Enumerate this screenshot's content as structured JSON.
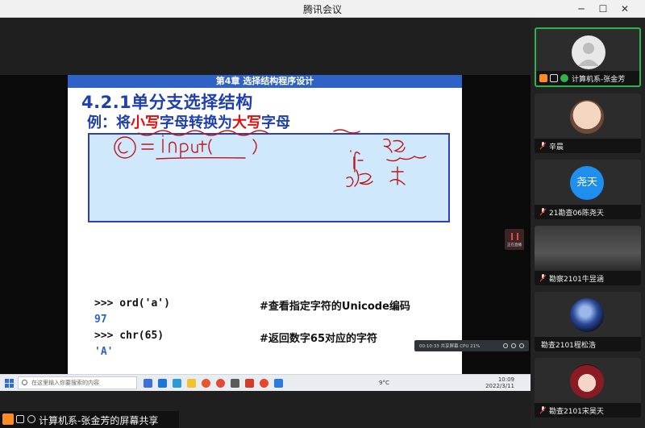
{
  "window": {
    "title": "腾讯会议",
    "min_glyph": "─",
    "max_glyph": "☐",
    "close_glyph": "✕"
  },
  "slide": {
    "chapter_header": "第4章 选择结构程序设计",
    "title": "4.2.1单分支选择结构",
    "subtitle_prefix": "例：将",
    "subtitle_red1": "小写",
    "subtitle_mid": "字母转换为",
    "subtitle_red2": "大写",
    "subtitle_suffix": "字母",
    "code_lines": [
      {
        "code": ">>> ord('a')",
        "comment": "#查看指定字符的Unicode编码"
      },
      {
        "code": "97",
        "comment": ""
      },
      {
        "code": ">>> chr(65)",
        "comment": "#返回数字65对应的字符"
      },
      {
        "code": "'A'",
        "comment": ""
      }
    ]
  },
  "taskbar": {
    "search_placeholder": "在这里输入你要搜索的内容",
    "weather": "9°C",
    "clock_time": "10:09",
    "clock_date": "2022/3/11"
  },
  "live_badge": {
    "label": "正在直播"
  },
  "rec_toolbar": {
    "text": "00:10:33  共享屏幕  CPU 21%"
  },
  "share_bar": {
    "text": "计算机系-张金芳的屏幕共享"
  },
  "participants": [
    {
      "name": "计算机系-张金芳",
      "avatar": "person-placeholder-icon",
      "active": true
    },
    {
      "name": "辛晨",
      "avatar": "baby-photo",
      "active": false
    },
    {
      "name": "21勘查06陈尧天",
      "avatar_text": "尧天",
      "avatar_color": "#1f8ef1",
      "active": false
    },
    {
      "name": "勘察2101牛昱涵",
      "avatar": "person-photo",
      "active": false
    },
    {
      "name": "勘查2101程松浩",
      "avatar": "space-photo",
      "active": false
    },
    {
      "name": "勘查2101宋昊天",
      "avatar": "anime-photo",
      "active": false
    }
  ],
  "colors": {
    "slide_blue": "#1f3fae",
    "slide_red": "#e01010",
    "header_blue": "#2e62c7",
    "box_fill": "#cfe8fb",
    "active_border": "#2fb34a",
    "accent_orange": "#ff8a1f"
  }
}
